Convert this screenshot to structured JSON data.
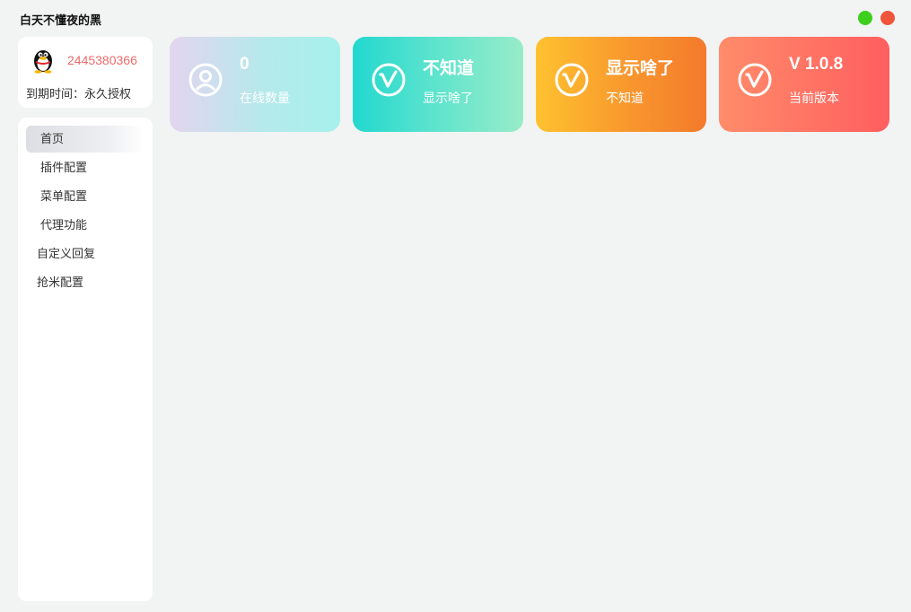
{
  "window": {
    "title": "白天不懂夜的黑"
  },
  "user": {
    "id": "2445380366",
    "expire_text": "到期时间：永久授权"
  },
  "nav": {
    "items": [
      {
        "label": "首页",
        "active": true
      },
      {
        "label": "插件配置"
      },
      {
        "label": "菜单配置"
      },
      {
        "label": "代理功能"
      },
      {
        "label": "自定义回复"
      },
      {
        "label": "抢米配置"
      }
    ]
  },
  "cards": [
    {
      "value": "0",
      "label": "在线数量",
      "icon": "user-circle-icon"
    },
    {
      "value": "不知道",
      "label": "显示啥了",
      "icon": "v-circle-icon"
    },
    {
      "value": "显示啥了",
      "label": "不知道",
      "icon": "v-circle-icon"
    },
    {
      "value": "V 1.0.8",
      "label": "当前版本",
      "icon": "v-circle-icon"
    }
  ],
  "colors": {
    "window_min": "#3ccf1e",
    "window_close": "#f0553c",
    "user_id": "#f06a6a"
  }
}
